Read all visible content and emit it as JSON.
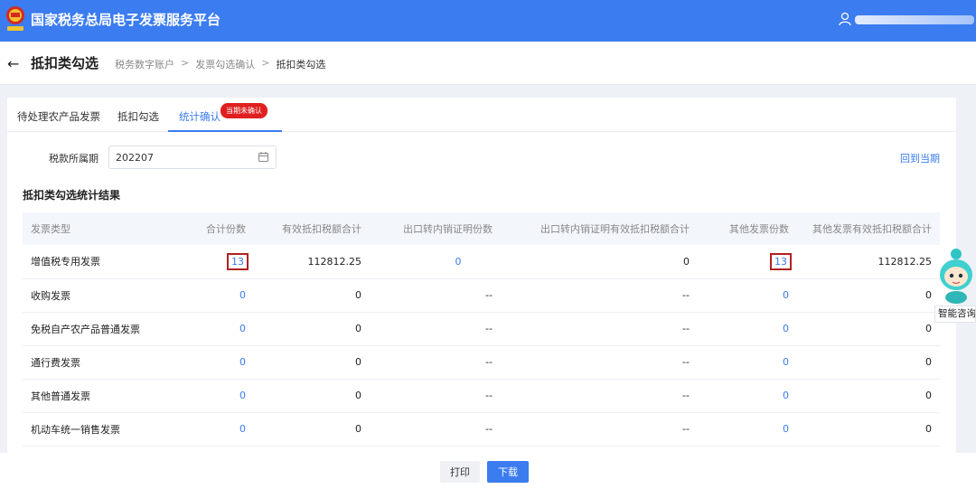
{
  "topbar": {
    "title": "国家税务总局电子发票服务平台"
  },
  "header": {
    "back_icon": "arrow-left-icon",
    "title": "抵扣类勾选",
    "breadcrumb": [
      "税务数字账户",
      "发票勾选确认",
      "抵扣类勾选"
    ],
    "breadcrumb_separator": ">"
  },
  "tabs": [
    {
      "label": "待处理农产品发票"
    },
    {
      "label": "抵扣勾选"
    },
    {
      "label": "统计确认",
      "active": true,
      "badge": "当期未确认"
    }
  ],
  "filter": {
    "period_label": "税款所属期",
    "period_value": "202207",
    "return_link": "回到当期"
  },
  "section_title": "抵扣类勾选统计结果",
  "table": {
    "headers": [
      "发票类型",
      "合计份数",
      "有效抵扣税额合计",
      "出口转内销证明份数",
      "出口转内销证明有效抵扣税额合计",
      "其他发票份数",
      "其他发票有效抵扣税额合计"
    ],
    "rows": [
      [
        "增值税专用发票",
        "13",
        "112812.25",
        "0",
        "0",
        "13",
        "112812.25"
      ],
      [
        "收购发票",
        "0",
        "0",
        "--",
        "--",
        "0",
        "0"
      ],
      [
        "免税自产农产品普通发票",
        "0",
        "0",
        "--",
        "--",
        "0",
        "0"
      ],
      [
        "通行费发票",
        "0",
        "0",
        "--",
        "--",
        "0",
        "0"
      ],
      [
        "其他普通发票",
        "0",
        "0",
        "--",
        "--",
        "0",
        "0"
      ],
      [
        "机动车统一销售发票",
        "0",
        "0",
        "--",
        "--",
        "0",
        "0"
      ]
    ]
  },
  "footer": {
    "print_label": "打印",
    "download_label": "下载"
  },
  "assistant": {
    "label": "智能咨询"
  },
  "colors": {
    "primary": "#3b7cf0",
    "badge": "#e02020",
    "highlight_box": "#b02020"
  }
}
